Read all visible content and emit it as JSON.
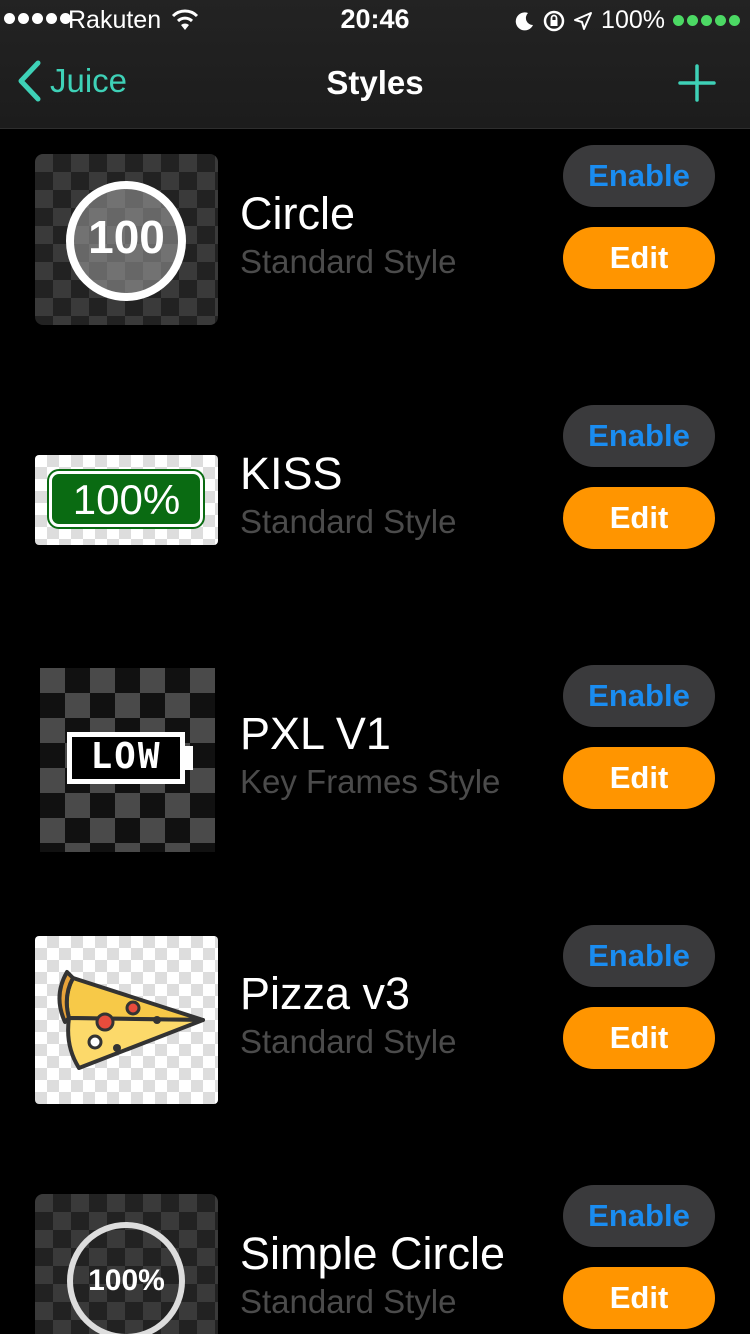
{
  "status_bar": {
    "carrier": "Rakuten",
    "time": "20:46",
    "battery": "100%"
  },
  "nav": {
    "back_label": "Juice",
    "title": "Styles",
    "add_icon": "plus-icon"
  },
  "colors": {
    "accent": "#3ed1b7",
    "enable_text": "#1a8cf0",
    "edit_bg": "#ff9500",
    "subtitle": "#4b4b4b"
  },
  "styles": [
    {
      "name": "Circle",
      "subtitle": "Standard Style",
      "thumb_text": "100",
      "enable_label": "Enable",
      "edit_label": "Edit"
    },
    {
      "name": "KISS",
      "subtitle": "Standard Style",
      "thumb_text": "100%",
      "enable_label": "Enable",
      "edit_label": "Edit"
    },
    {
      "name": "PXL V1",
      "subtitle": "Key Frames Style",
      "thumb_text": "LOW",
      "enable_label": "Enable",
      "edit_label": "Edit"
    },
    {
      "name": "Pizza v3",
      "subtitle": "Standard Style",
      "thumb_text": "",
      "enable_label": "Enable",
      "edit_label": "Edit"
    },
    {
      "name": "Simple Circle",
      "subtitle": "Standard Style",
      "thumb_text": "100%",
      "enable_label": "Enable",
      "edit_label": "Edit"
    }
  ]
}
